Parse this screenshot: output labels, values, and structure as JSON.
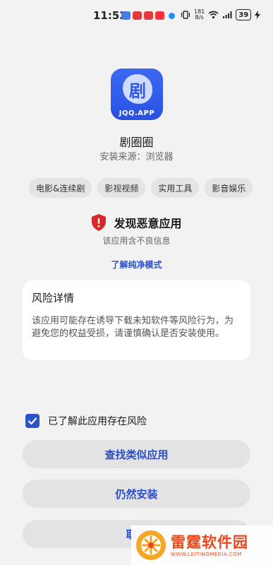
{
  "status_bar": {
    "time": "11:52",
    "net_speed_value": "181",
    "net_speed_unit": "B/s",
    "battery": "39"
  },
  "app": {
    "icon_char": "剧",
    "icon_brand": "JQQ.APP",
    "name": "剧圈圈",
    "source": "安装来源：浏览器"
  },
  "tags": [
    "电影&连续剧",
    "影视视频",
    "实用工具",
    "影音娱乐"
  ],
  "warning": {
    "title": "发现恶意应用",
    "subtitle": "该应用含不良信息",
    "link": "了解纯净模式"
  },
  "risk_card": {
    "title": "风险详情",
    "body": "该应用可能存在诱导下载未知软件等风险行为，为避免您的权益受损，请谨慎确认是否安装使用。"
  },
  "acknowledge": {
    "label": "已了解此应用存在风险",
    "checked": true
  },
  "buttons": {
    "find_similar": "查找类似应用",
    "install_anyway": "仍然安装",
    "cancel": "取消"
  },
  "watermark": {
    "title": "雷霆软件园",
    "url": "WWW.LEITINGMEDIA.COM"
  },
  "colors": {
    "accent": "#2a4ec8",
    "danger": "#d62a2a",
    "icon_bg": "#2f58e8"
  }
}
